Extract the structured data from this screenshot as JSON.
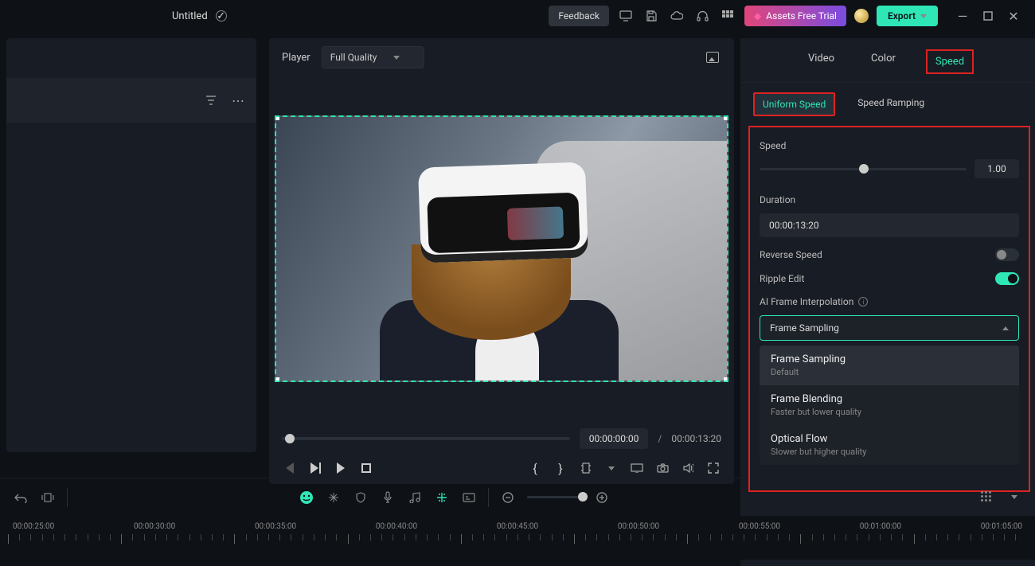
{
  "titlebar": {
    "project_name": "Untitled",
    "feedback_label": "Feedback",
    "assets_trial_label": "Assets Free Trial",
    "export_label": "Export"
  },
  "player": {
    "label": "Player",
    "quality": "Full Quality",
    "current_time": "00:00:00:00",
    "total_time": "00:00:13:20"
  },
  "inspector": {
    "tabs": {
      "video": "Video",
      "color": "Color",
      "speed": "Speed"
    },
    "subtabs": {
      "uniform": "Uniform Speed",
      "ramping": "Speed Ramping"
    },
    "speed_label": "Speed",
    "speed_value": "1.00",
    "duration_label": "Duration",
    "duration_value": "00:00:13:20",
    "reverse_label": "Reverse Speed",
    "ripple_label": "Ripple Edit",
    "ai_label": "AI Frame Interpolation",
    "ai_selected": "Frame Sampling",
    "options": [
      {
        "name": "Frame Sampling",
        "desc": "Default"
      },
      {
        "name": "Frame Blending",
        "desc": "Faster but lower quality"
      },
      {
        "name": "Optical Flow",
        "desc": "Slower but higher quality"
      }
    ]
  },
  "ruler": {
    "labels": [
      "00:00:25:00",
      "00:00:30:00",
      "00:00:35:00",
      "00:00:40:00",
      "00:00:45:00",
      "00:00:50:00",
      "00:00:55:00",
      "00:01:00:00",
      "00:01:05:00"
    ]
  }
}
